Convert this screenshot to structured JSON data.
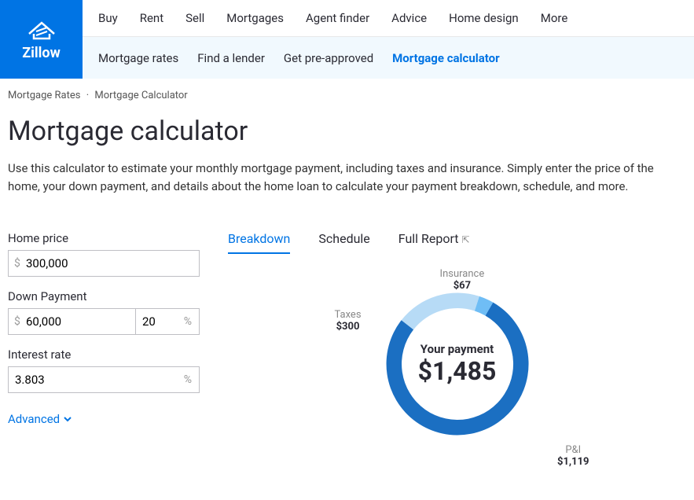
{
  "brand": "Zillow",
  "topnav": [
    "Buy",
    "Rent",
    "Sell",
    "Mortgages",
    "Agent finder",
    "Advice",
    "Home design",
    "More"
  ],
  "subnav": [
    {
      "label": "Mortgage rates",
      "active": false
    },
    {
      "label": "Find a lender",
      "active": false
    },
    {
      "label": "Get pre-approved",
      "active": false
    },
    {
      "label": "Mortgage calculator",
      "active": true
    }
  ],
  "breadcrumb": [
    "Mortgage Rates",
    "Mortgage Calculator"
  ],
  "title": "Mortgage calculator",
  "description": "Use this calculator to estimate your monthly mortgage payment, including taxes and insurance. Simply enter the price of the home, your down payment, and details about the home loan to calculate your payment breakdown, schedule, and more.",
  "form": {
    "home_price_label": "Home price",
    "home_price_value": "300,000",
    "down_payment_label": "Down Payment",
    "down_payment_value": "60,000",
    "down_payment_pct": "20",
    "interest_label": "Interest rate",
    "interest_value": "3.803",
    "advanced_label": "Advanced"
  },
  "tabs": [
    "Breakdown",
    "Schedule",
    "Full Report"
  ],
  "active_tab": "Breakdown",
  "chart_data": {
    "type": "donut",
    "title": "Your payment",
    "total": "$1,485",
    "segments": [
      {
        "name": "Insurance",
        "value": 67,
        "display": "$67",
        "color": "#6fbdf5"
      },
      {
        "name": "Taxes",
        "value": 300,
        "display": "$300",
        "color": "#b7dbf6"
      },
      {
        "name": "P&I",
        "value": 1119,
        "display": "$1,119",
        "color": "#1b6fc2"
      }
    ]
  }
}
